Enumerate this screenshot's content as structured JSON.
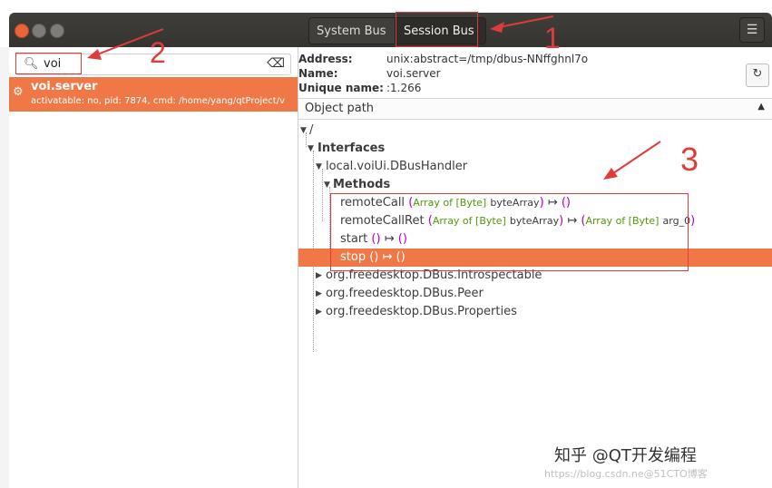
{
  "tabs": [
    {
      "label": "System Bus"
    },
    {
      "label": "Session Bus"
    }
  ],
  "search": {
    "value": "voi"
  },
  "server_item": {
    "name": "voi.server",
    "desc": "activatable: no, pid: 7874, cmd: /home/yang/qtProject/v"
  },
  "info": {
    "address_label": "Address:",
    "address_value": "unix:abstract=/tmp/dbus-NNffghnl7o",
    "name_label": "Name:",
    "name_value": "voi.server",
    "unique_label": "Unique name:",
    "unique_value": ":1.266"
  },
  "object_path_header": "Object path",
  "tree": {
    "root": "/",
    "interfaces": "Interfaces",
    "iface_handler": "local.voiUi.DBusHandler",
    "methods": "Methods",
    "m1_name": "remoteCall",
    "m1_arg_open": "(",
    "m1_arg_type": "Array of [Byte]",
    "m1_arg_name": "byteArray",
    "m1_arg_close": ")",
    "m1_arrow": "↦",
    "m1_ret": "()",
    "m2_name": "remoteCallRet",
    "m2_arg_open": "(",
    "m2_arg_type": "Array of [Byte]",
    "m2_arg_name": "byteArray",
    "m2_arg_close": ")",
    "m2_arrow": "↦",
    "m2_ret_open": "(",
    "m2_ret_type": "Array of [Byte]",
    "m2_ret_name": "arg_0",
    "m2_ret_close": ")",
    "m3_name": "start",
    "m3_args": "()",
    "m3_arrow": "↦",
    "m3_ret": "()",
    "m4_name": "stop",
    "m4_args": "()",
    "m4_arrow": "↦",
    "m4_ret": "()",
    "iface_intro": "org.freedesktop.DBus.Introspectable",
    "iface_peer": "org.freedesktop.DBus.Peer",
    "iface_props": "org.freedesktop.DBus.Properties"
  },
  "annotations": {
    "n1": "1",
    "n2": "2",
    "n3": "3"
  },
  "watermarks": {
    "zhihu": "知乎 @QT开发编程",
    "blog": "https://blog.csdn.ne@51CTO博客"
  },
  "colors": {
    "selection": "#f07746",
    "annotation": "#e03b3b",
    "type_green": "#4e9a06",
    "paren_magenta": "#b300b3"
  }
}
